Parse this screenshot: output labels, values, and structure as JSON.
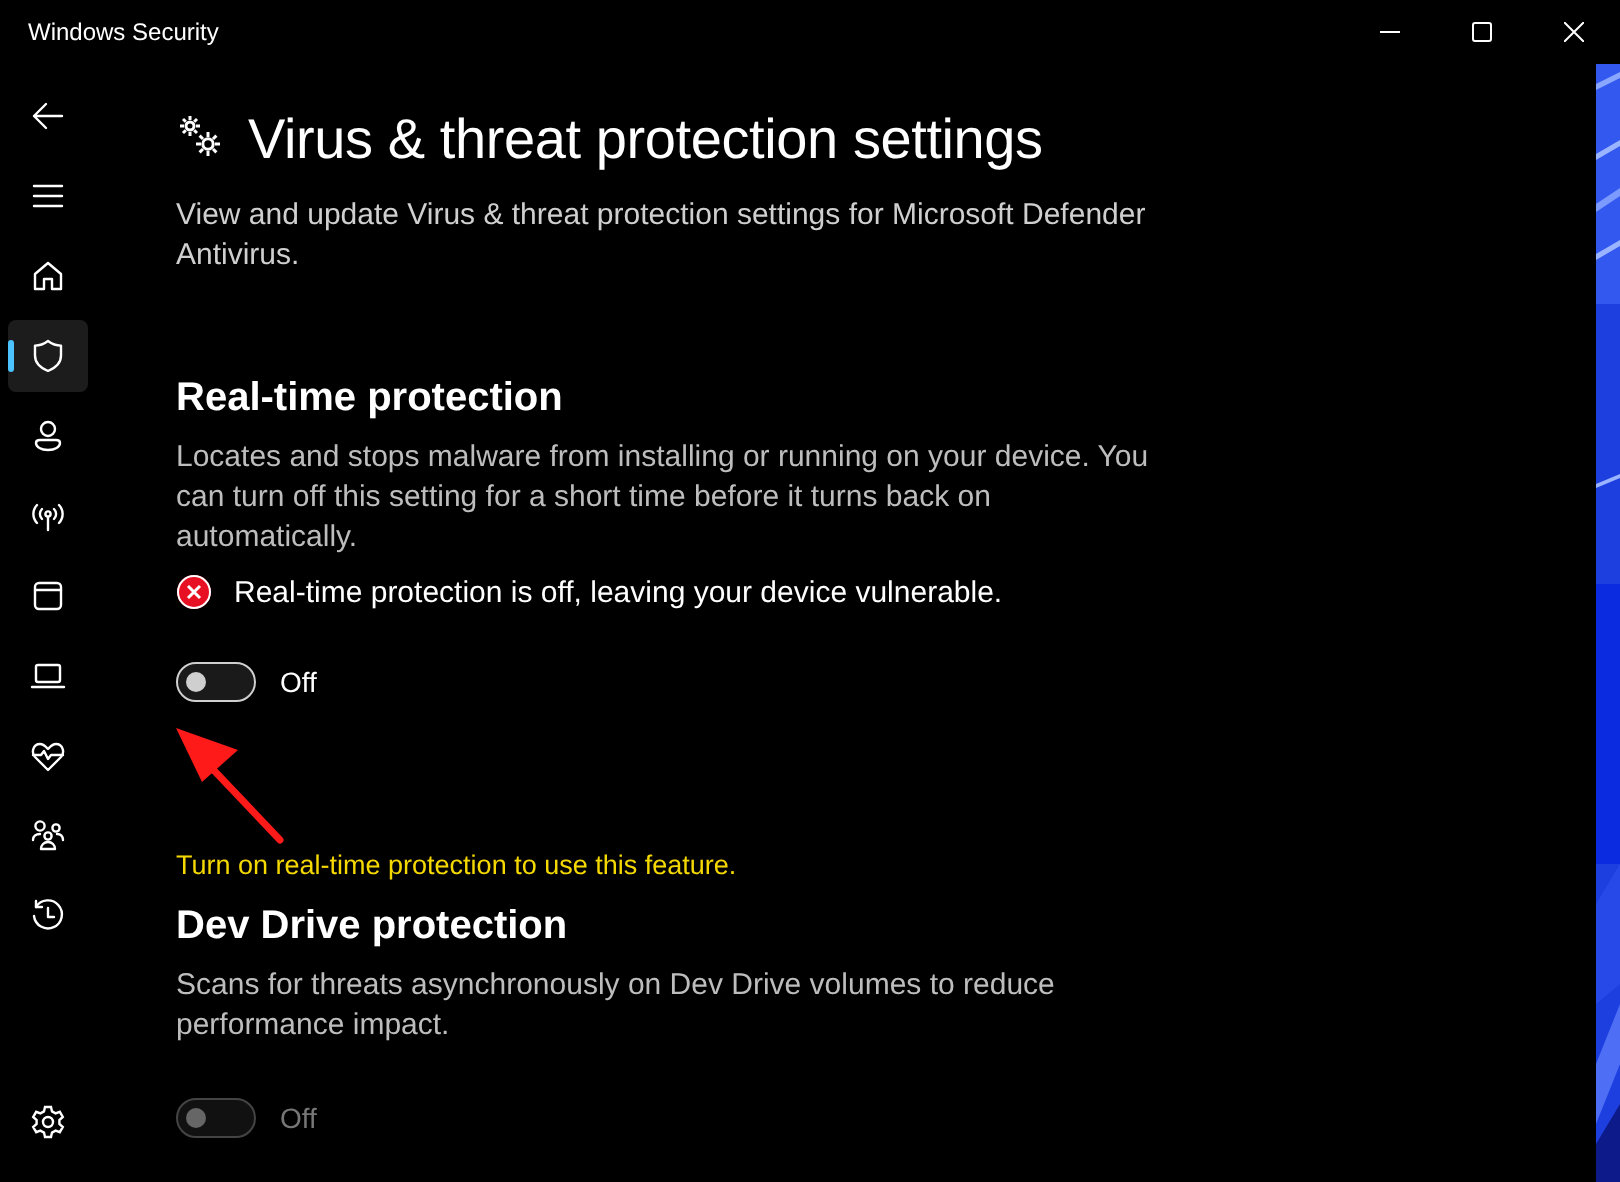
{
  "window": {
    "title": "Windows Security",
    "controls": [
      {
        "kind": "minimize"
      },
      {
        "kind": "maximize"
      },
      {
        "kind": "close"
      }
    ]
  },
  "sidebar": {
    "items": [
      {
        "kind": "back",
        "selected": false
      },
      {
        "kind": "menu",
        "selected": false
      },
      {
        "kind": "home",
        "selected": false
      },
      {
        "kind": "shield",
        "selected": true
      },
      {
        "kind": "person",
        "selected": false
      },
      {
        "kind": "antenna",
        "selected": false
      },
      {
        "kind": "window",
        "selected": false
      },
      {
        "kind": "laptop",
        "selected": false
      },
      {
        "kind": "heart",
        "selected": false
      },
      {
        "kind": "family",
        "selected": false
      },
      {
        "kind": "history",
        "selected": false
      }
    ],
    "footer": [
      {
        "kind": "settings",
        "selected": false
      }
    ]
  },
  "page": {
    "title": "Virus & threat protection settings",
    "description": "View and update Virus & threat protection settings for Microsoft Defender Antivirus.",
    "sections": [
      {
        "heading": "Real-time protection",
        "description": "Locates and stops malware from installing or running on your device. You can turn off this setting for a short time before it turns back on automatically.",
        "status": {
          "kind": "error",
          "text": "Real-time protection is off, leaving your device vulnerable."
        },
        "toggle": {
          "on": false,
          "disabled": false,
          "label": "Off"
        }
      },
      {
        "warning": "Turn on real-time protection to use this feature.",
        "heading": "Dev Drive protection",
        "description": "Scans for threats asynchronously on Dev Drive volumes to reduce performance impact.",
        "toggle": {
          "on": false,
          "disabled": true,
          "label": "Off"
        }
      }
    ]
  }
}
